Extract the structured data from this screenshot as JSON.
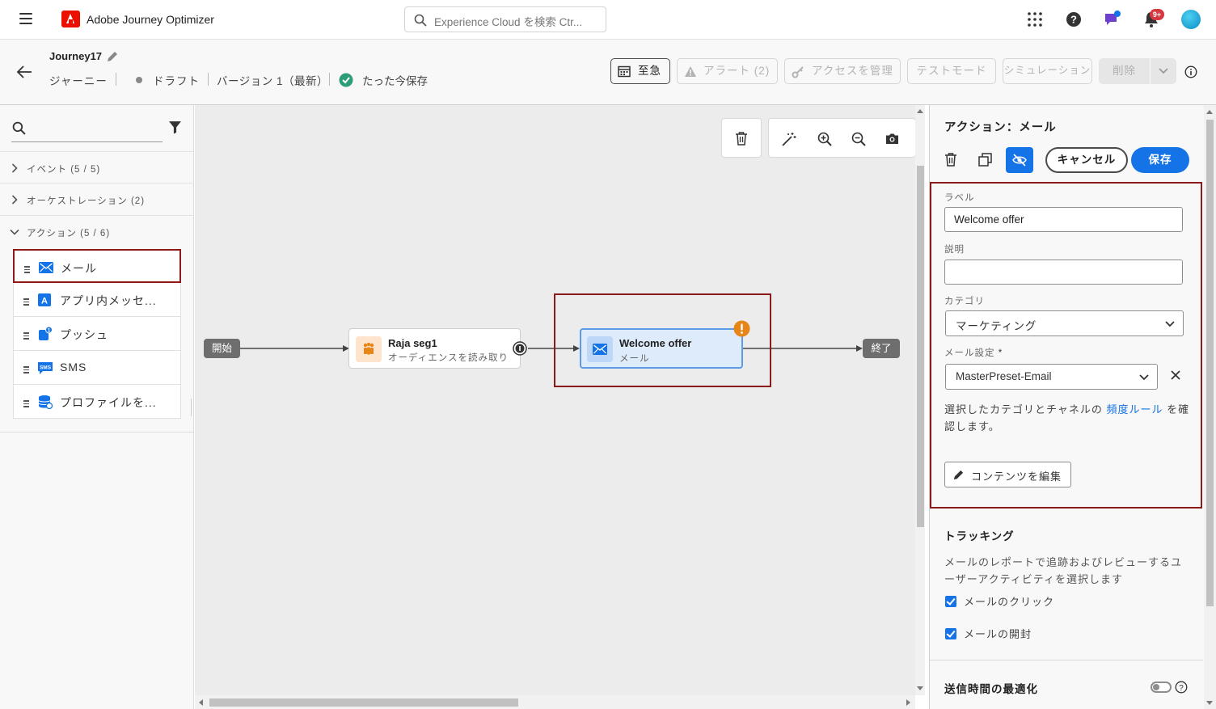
{
  "app": {
    "name": "Adobe Journey Optimizer",
    "search_placeholder": "Experience Cloud を検索 Ctr...",
    "notification_badge": "9+"
  },
  "journey": {
    "name": "Journey17",
    "type": "ジャーニー",
    "status": "ドラフト",
    "version": "バージョン 1（最新）",
    "save_status": "たった今保存"
  },
  "header_buttons": {
    "schedule": "至急",
    "alerts": "アラート (2)",
    "manage_access": "アクセスを管理",
    "test_mode": "テストモード",
    "simulation": "シミュレーション",
    "delete": "削除"
  },
  "palette": {
    "categories": [
      {
        "label": "イベント (5 / 5)"
      },
      {
        "label": "オーケストレーション (2)"
      },
      {
        "label": "アクション (5 / 6)"
      }
    ],
    "actions": [
      {
        "label": "メール",
        "icon": "email-icon"
      },
      {
        "label": "アプリ内メッセ...",
        "icon": "in-app-icon"
      },
      {
        "label": "プッシュ",
        "icon": "push-icon"
      },
      {
        "label": "SMS",
        "icon": "sms-icon"
      },
      {
        "label": "プロファイルを...",
        "icon": "profile-update-icon"
      }
    ]
  },
  "canvas": {
    "start_label": "開始",
    "end_label": "終了",
    "audience_node": {
      "title": "Raja seg1",
      "subtitle": "オーディエンスを読み取り"
    },
    "email_node": {
      "title": "Welcome offer",
      "subtitle": "メール"
    }
  },
  "panel": {
    "title": "アクション：メール",
    "cancel": "キャンセル",
    "save": "保存",
    "label_title": "ラベル",
    "label_value": "Welcome offer",
    "description_title": "説明",
    "description_value": "",
    "category_title": "カテゴリ",
    "category_value": "マーケティング",
    "email_settings_title": "メール設定",
    "required_mark": "*",
    "email_settings_value": "MasterPreset-Email",
    "frequency_text_before": "選択したカテゴリとチャネルの",
    "frequency_link": "頻度ルール",
    "frequency_text_after": "を確認します。",
    "edit_content": "コンテンツを編集",
    "tracking_title": "トラッキング",
    "tracking_desc": "メールのレポートで追跡およびレビューするユーザーアクティビティを選択します",
    "track_clicks": "メールのクリック",
    "track_opens": "メールの開封",
    "send_time_title": "送信時間の最適化"
  },
  "colors": {
    "accent": "#1473e6",
    "highlight": "#8b1a1a",
    "warning": "#e68619",
    "success": "#2d9d78"
  }
}
